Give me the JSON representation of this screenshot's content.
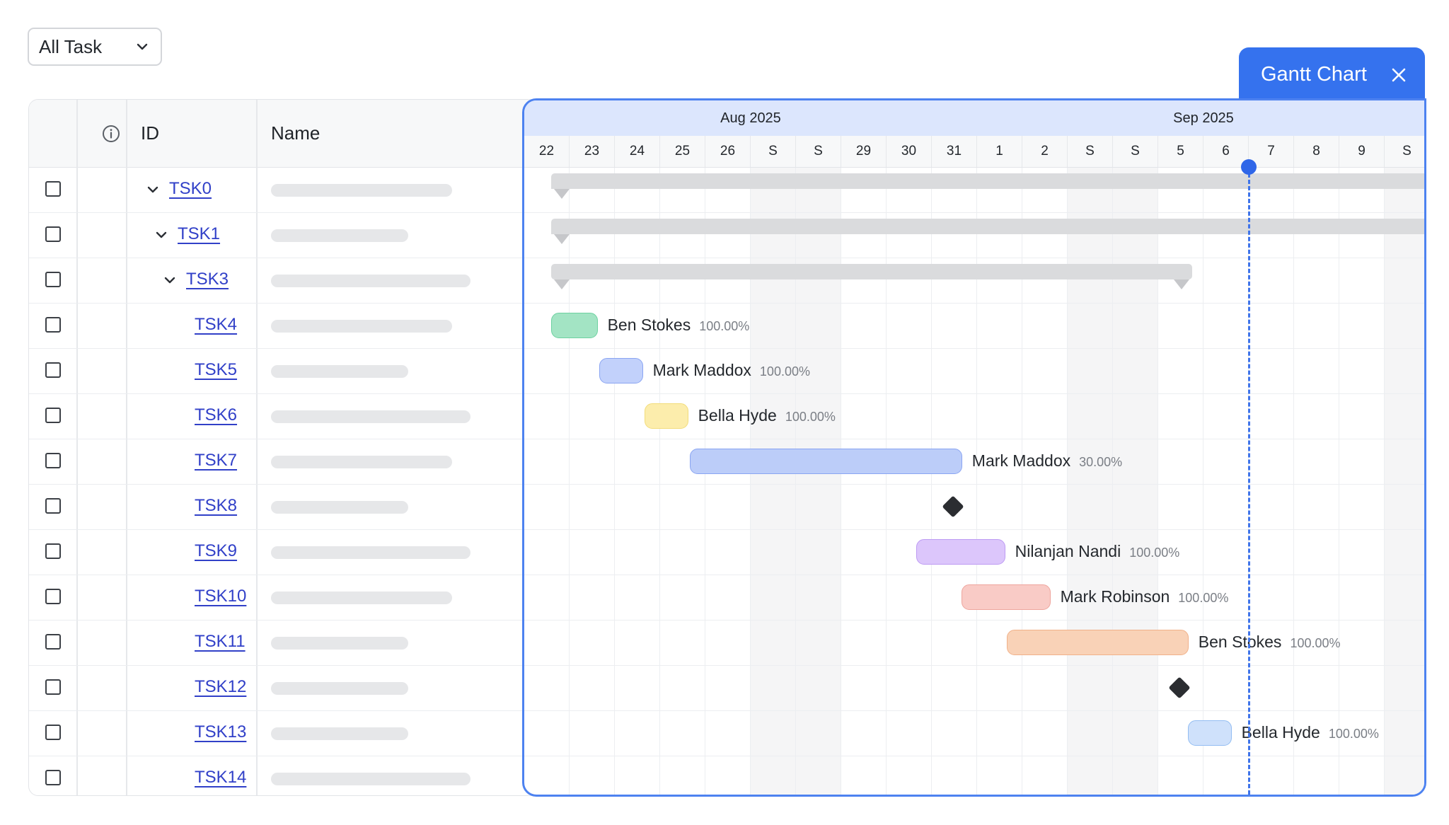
{
  "filter": {
    "value": "All Task",
    "icon": "chevron-down-icon"
  },
  "table": {
    "columns": {
      "info_icon": "info-icon",
      "id": "ID",
      "name": "Name"
    },
    "rows": [
      {
        "id": "TSK0",
        "level": 0,
        "expandable": true
      },
      {
        "id": "TSK1",
        "level": 1,
        "expandable": true
      },
      {
        "id": "TSK3",
        "level": 2,
        "expandable": true
      },
      {
        "id": "TSK4",
        "level": 3,
        "expandable": false
      },
      {
        "id": "TSK5",
        "level": 3,
        "expandable": false
      },
      {
        "id": "TSK6",
        "level": 3,
        "expandable": false
      },
      {
        "id": "TSK7",
        "level": 3,
        "expandable": false
      },
      {
        "id": "TSK8",
        "level": 3,
        "expandable": false
      },
      {
        "id": "TSK9",
        "level": 3,
        "expandable": false
      },
      {
        "id": "TSK10",
        "level": 3,
        "expandable": false
      },
      {
        "id": "TSK11",
        "level": 3,
        "expandable": false
      },
      {
        "id": "TSK12",
        "level": 3,
        "expandable": false
      },
      {
        "id": "TSK13",
        "level": 3,
        "expandable": false
      },
      {
        "id": "TSK14",
        "level": 3,
        "expandable": false
      }
    ]
  },
  "gantt": {
    "tab": {
      "title": "Gantt Chart",
      "close_icon": "close-icon"
    },
    "months": [
      "Aug 2025",
      "Sep 2025"
    ],
    "days": [
      "22",
      "23",
      "24",
      "25",
      "26",
      "S",
      "S",
      "29",
      "30",
      "31",
      "1",
      "2",
      "S",
      "S",
      "5",
      "6",
      "7",
      "8",
      "9",
      "S"
    ],
    "today": "6",
    "rows": [
      {
        "type": "summary"
      },
      {
        "type": "summary"
      },
      {
        "type": "summary"
      },
      {
        "type": "task",
        "assignee": "Ben Stokes",
        "progress": "100.00%",
        "color": "#a3e4c4",
        "border": "#6dd1a0"
      },
      {
        "type": "task",
        "assignee": "Mark Maddox",
        "progress": "100.00%",
        "color": "#c2d1fb",
        "border": "#8aa5f2"
      },
      {
        "type": "task",
        "assignee": "Bella Hyde",
        "progress": "100.00%",
        "color": "#fcedac",
        "border": "#f2dc7a"
      },
      {
        "type": "task",
        "assignee": "Mark Maddox",
        "progress": "30.00%",
        "color": "#bccdf9",
        "border": "#8aa5f2"
      },
      {
        "type": "milestone"
      },
      {
        "type": "task",
        "assignee": "Nilanjan Nandi",
        "progress": "100.00%",
        "color": "#dcc6fb",
        "border": "#bd9bf3"
      },
      {
        "type": "task",
        "assignee": "Mark Robinson",
        "progress": "100.00%",
        "color": "#f9cbc6",
        "border": "#eea59d"
      },
      {
        "type": "task",
        "assignee": "Ben Stokes",
        "progress": "100.00%",
        "color": "#f9d2b7",
        "border": "#f1b189"
      },
      {
        "type": "milestone"
      },
      {
        "type": "task",
        "assignee": "Bella Hyde",
        "progress": "100.00%",
        "color": "#cfe1fb",
        "border": "#93bdf2"
      },
      {
        "type": "empty"
      }
    ]
  }
}
